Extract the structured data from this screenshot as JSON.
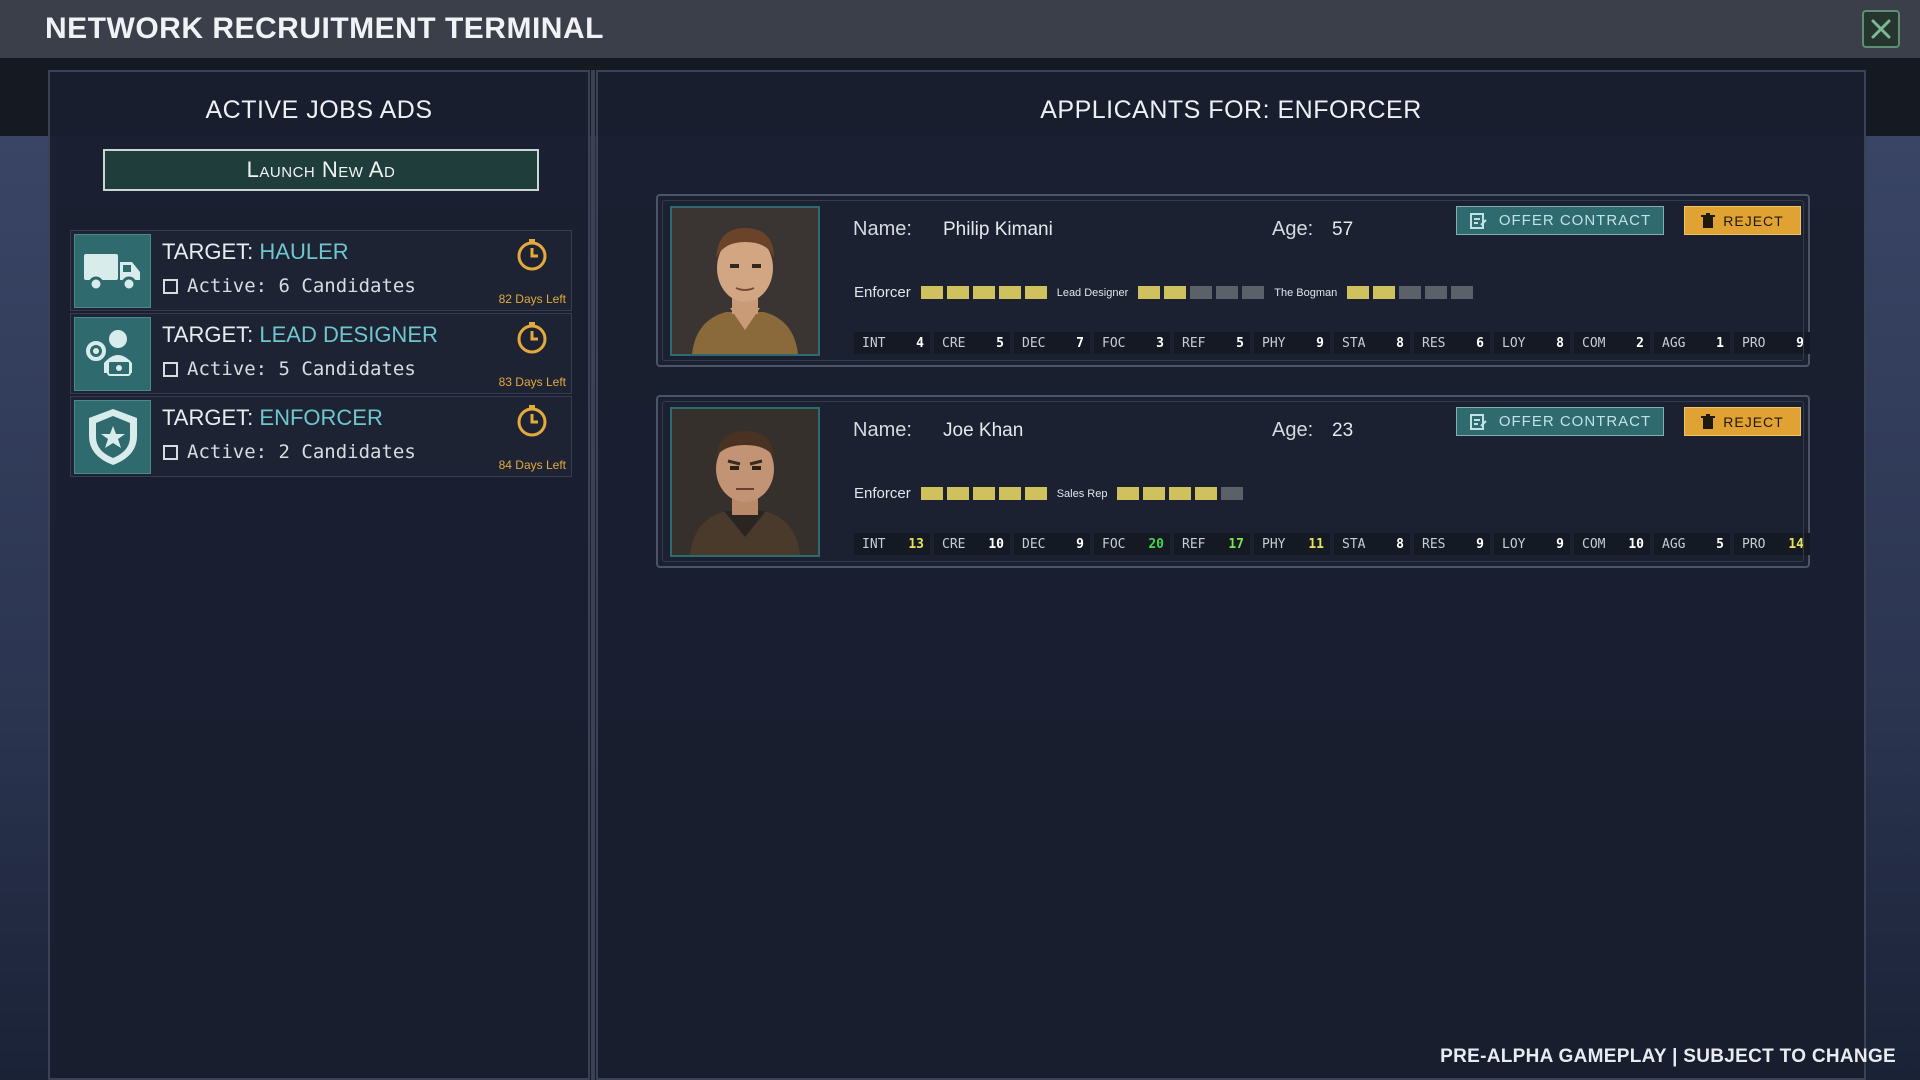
{
  "window": {
    "title": "NETWORK RECRUITMENT TERMINAL"
  },
  "left": {
    "title": "ACTIVE JOBS ADS",
    "launch_label": "Launch New Ad",
    "jobs": [
      {
        "target_prefix": "TARGET: ",
        "role": "HAULER",
        "active": "Active: 6 Candidates",
        "days": "82 Days Left",
        "icon": "truck-icon"
      },
      {
        "target_prefix": "TARGET: ",
        "role": "LEAD DESIGNER",
        "active": "Active: 5 Candidates",
        "days": "83 Days Left",
        "icon": "designer-icon"
      },
      {
        "target_prefix": "TARGET: ",
        "role": "ENFORCER",
        "active": "Active: 2 Candidates",
        "days": "84 Days Left",
        "icon": "shield-star-icon"
      }
    ]
  },
  "right": {
    "title": "APPLICANTS FOR: ENFORCER",
    "name_label": "Name:",
    "age_label": "Age:",
    "offer_label": "OFFER CONTRACT",
    "reject_label": "REJECT",
    "applicants": [
      {
        "name": "Philip Kimani",
        "age": "57",
        "skills": [
          {
            "label": "Enforcer",
            "level": 5,
            "max": 5
          },
          {
            "label": "Lead Designer",
            "level": 2,
            "max": 5
          },
          {
            "label": "The Bogman",
            "level": 2,
            "max": 5
          }
        ],
        "stats": [
          {
            "k": "INT",
            "v": "4"
          },
          {
            "k": "CRE",
            "v": "5"
          },
          {
            "k": "DEC",
            "v": "7"
          },
          {
            "k": "FOC",
            "v": "3"
          },
          {
            "k": "REF",
            "v": "5"
          },
          {
            "k": "PHY",
            "v": "9"
          },
          {
            "k": "STA",
            "v": "8"
          },
          {
            "k": "RES",
            "v": "6"
          },
          {
            "k": "LOY",
            "v": "8"
          },
          {
            "k": "COM",
            "v": "2"
          },
          {
            "k": "AGG",
            "v": "1"
          },
          {
            "k": "PRO",
            "v": "9"
          }
        ]
      },
      {
        "name": "Joe Khan",
        "age": "23",
        "skills": [
          {
            "label": "Enforcer",
            "level": 5,
            "max": 5
          },
          {
            "label": "Sales Rep",
            "level": 4,
            "max": 5
          }
        ],
        "stats": [
          {
            "k": "INT",
            "v": "13",
            "color": "#e7e35a"
          },
          {
            "k": "CRE",
            "v": "10"
          },
          {
            "k": "DEC",
            "v": "9"
          },
          {
            "k": "FOC",
            "v": "20",
            "color": "#43d64a"
          },
          {
            "k": "REF",
            "v": "17",
            "color": "#7ee34f"
          },
          {
            "k": "PHY",
            "v": "11",
            "color": "#e7e35a"
          },
          {
            "k": "STA",
            "v": "8"
          },
          {
            "k": "RES",
            "v": "9"
          },
          {
            "k": "LOY",
            "v": "9"
          },
          {
            "k": "COM",
            "v": "10"
          },
          {
            "k": "AGG",
            "v": "5"
          },
          {
            "k": "PRO",
            "v": "14",
            "color": "#e7e35a"
          }
        ]
      }
    ]
  },
  "footer": "PRE-ALPHA GAMEPLAY | SUBJECT TO CHANGE",
  "colors": {
    "accent_teal": "#6ec6cf",
    "reject": "#e0a233",
    "skill_bar": "#cfc25e",
    "timer": "#e4aa3c"
  }
}
